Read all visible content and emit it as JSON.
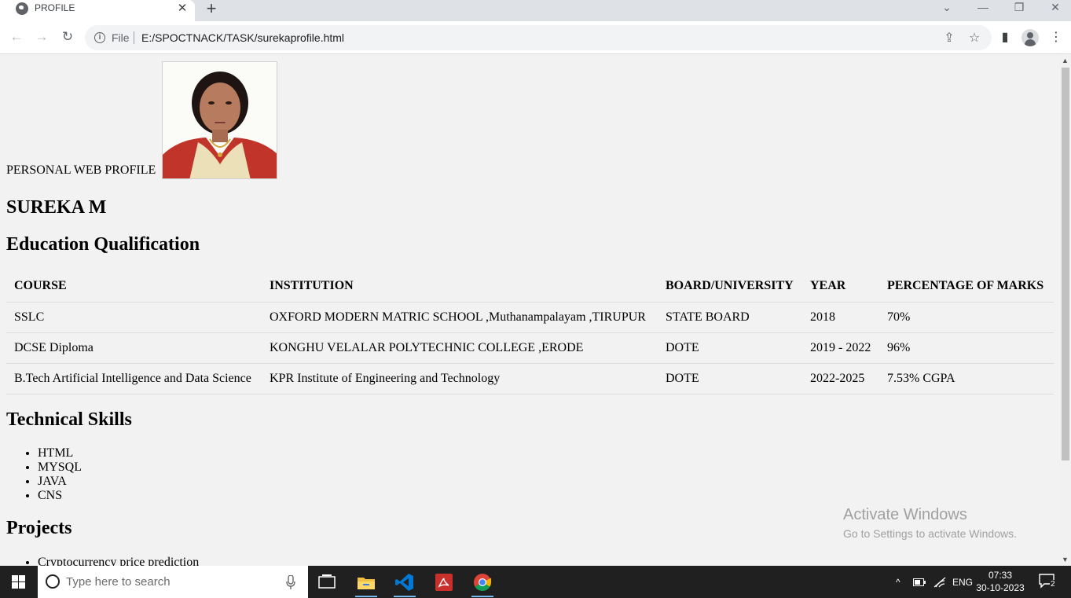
{
  "browser": {
    "tab_title": "PROFILE",
    "new_tab_label": "+",
    "close_tab_label": "✕",
    "window_controls": {
      "dropdown": "⌄",
      "minimize": "—",
      "restore": "❐",
      "close": "✕"
    },
    "address_scheme": "File",
    "address_url": "E:/SPOCTNACK/TASK/surekaprofile.html",
    "nav": {
      "back": "←",
      "forward": "→",
      "reload": "↻"
    },
    "icons": {
      "share": "⇪",
      "star": "☆",
      "sidepanel": "▮",
      "menu": "⋮"
    }
  },
  "profile": {
    "header_text": "PERSONAL WEB PROFILE",
    "name": "SUREKA M"
  },
  "education": {
    "title": "Education Qualification",
    "columns": [
      "COURSE",
      "INSTITUTION",
      "BOARD/UNIVERSITY",
      "YEAR",
      "PERCENTAGE OF MARKS"
    ],
    "rows": [
      [
        "SSLC",
        "OXFORD MODERN MATRIC SCHOOL ,Muthanampalayam ,TIRUPUR",
        "STATE BOARD",
        "2018",
        "70%"
      ],
      [
        "DCSE Diploma",
        "KONGHU VELALAR POLYTECHNIC COLLEGE ,ERODE",
        "DOTE",
        "2019 - 2022",
        "96%"
      ],
      [
        "B.Tech Artificial Intelligence and Data Science",
        "KPR Institute of Engineering and Technology",
        "DOTE",
        "2022-2025",
        "7.53% CGPA"
      ]
    ]
  },
  "skills": {
    "title": "Technical Skills",
    "items": [
      "HTML",
      "MYSQL",
      "JAVA",
      "CNS"
    ]
  },
  "projects": {
    "title": "Projects",
    "items": [
      "Cryptocurrency price prediction"
    ]
  },
  "watermark": {
    "title": "Activate Windows",
    "subtitle": "Go to Settings to activate Windows."
  },
  "taskbar": {
    "search_placeholder": "Type here to search",
    "tray_lang": "ENG",
    "time": "07:33",
    "date": "30-10-2023",
    "notification_count": "2"
  },
  "colors": {
    "page_background": "#f2f2f2",
    "tab_strip": "#dee1e6",
    "taskbar": "#202020",
    "vscode_blue": "#0078d4",
    "acrobat_red": "#c9302c",
    "chrome_red": "#db4437",
    "chrome_green": "#0f9d58",
    "chrome_yellow": "#f4b400"
  }
}
